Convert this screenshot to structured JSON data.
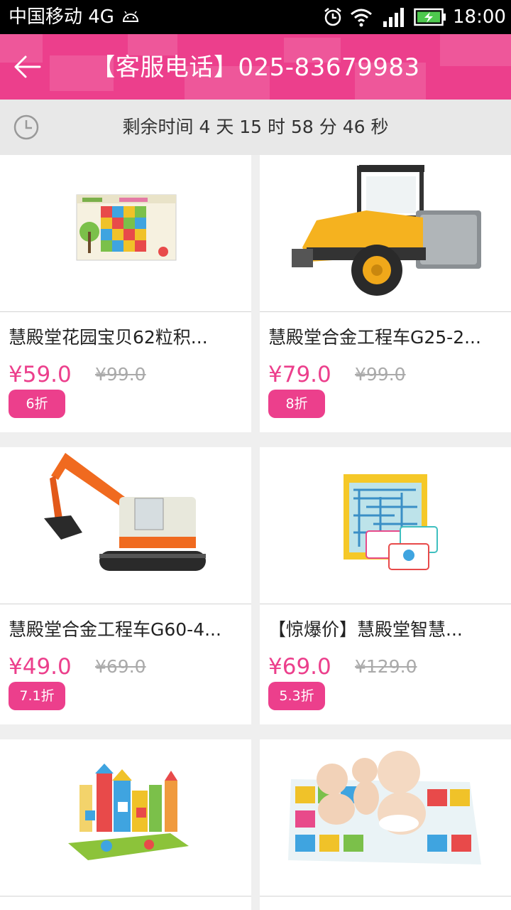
{
  "status_bar": {
    "carrier": "中国移动 4G",
    "time": "18:00"
  },
  "header": {
    "title": "【客服电话】025-83679983"
  },
  "countdown": {
    "text": "剩余时间 4 天 15 时 58 分 46 秒"
  },
  "products": [
    {
      "title": "慧殿堂花园宝贝62粒积...",
      "price": "¥59.0",
      "original_price": "¥99.0",
      "discount": "6折"
    },
    {
      "title": "慧殿堂合金工程车G25-2...",
      "price": "¥79.0",
      "original_price": "¥99.0",
      "discount": "8折"
    },
    {
      "title": "慧殿堂合金工程车G60-4...",
      "price": "¥49.0",
      "original_price": "¥69.0",
      "discount": "7.1折"
    },
    {
      "title": "【惊爆价】慧殿堂智慧...",
      "price": "¥69.0",
      "original_price": "¥129.0",
      "discount": "5.3折"
    },
    {
      "title": "",
      "price": "",
      "original_price": "",
      "discount": ""
    },
    {
      "title": "",
      "price": "",
      "original_price": "",
      "discount": ""
    }
  ],
  "colors": {
    "accent": "#ec3f8c",
    "countdown_bg": "#e8e8e8",
    "page_bg": "#efefef"
  }
}
